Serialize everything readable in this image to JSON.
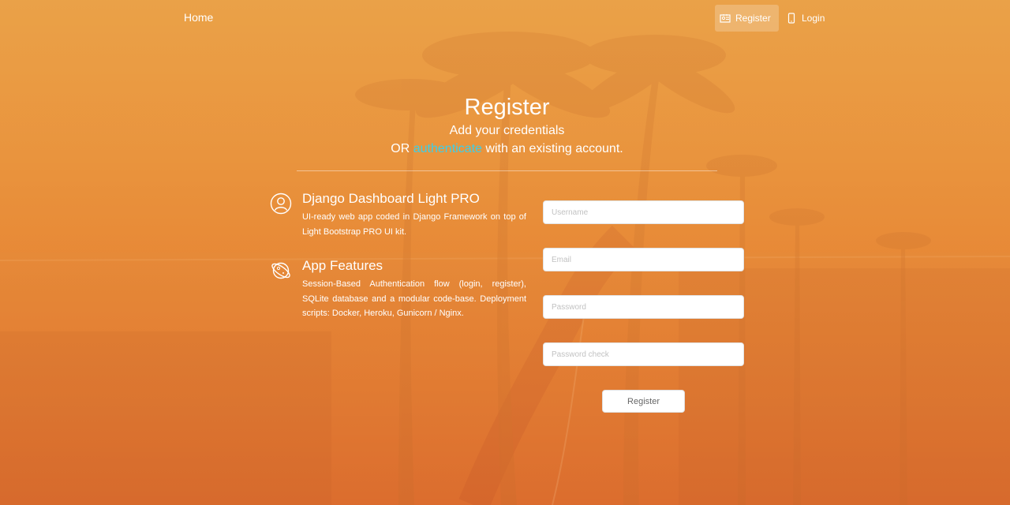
{
  "nav": {
    "home_label": "Home",
    "register_label": "Register",
    "login_label": "Login"
  },
  "header": {
    "title": "Register",
    "subtitle": "Add your credentials",
    "line_prefix": "OR ",
    "link_text": "authenticate",
    "line_suffix": " with an existing account."
  },
  "features": [
    {
      "icon": "user-circle-icon",
      "title": "Django Dashboard Light PRO",
      "text": "UI-ready web app coded in Django Framework on top of Light Bootstrap PRO UI kit."
    },
    {
      "icon": "planet-icon",
      "title": "App Features",
      "text": "Session-Based Authentication flow (login, register), SQLite database and a modular code-base. Deployment scripts: Docker, Heroku, Gunicorn / Nginx."
    }
  ],
  "form": {
    "username_placeholder": "Username",
    "email_placeholder": "Email",
    "password_placeholder": "Password",
    "password_check_placeholder": "Password check",
    "submit_label": "Register"
  },
  "colors": {
    "accent_link": "#3ad0ea",
    "background_top": "#e8a34a",
    "background_bottom": "#d9652a"
  }
}
